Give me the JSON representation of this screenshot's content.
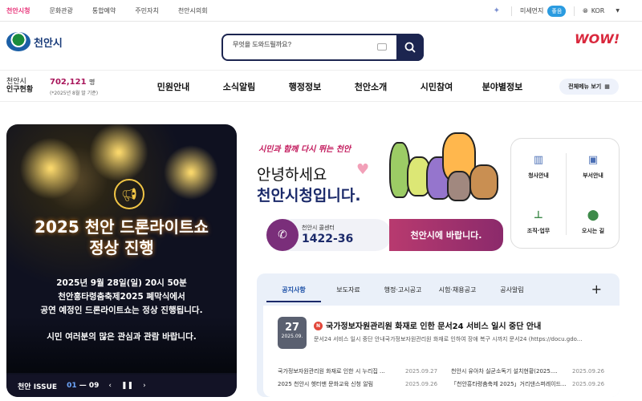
{
  "topbar": {
    "sites": [
      "천안시청",
      "문화관광",
      "통합예약",
      "주민자치",
      "천안시의회"
    ],
    "dust_label": "미세먼지",
    "dust_value": "좋음",
    "lang": "KOR"
  },
  "header": {
    "logo": "천안시",
    "search_placeholder": "무엇을 도와드릴까요?",
    "brand_slogan": "WOW!"
  },
  "population": {
    "label1": "천안시",
    "label2": "인구현황",
    "value": "702,121",
    "unit": "명",
    "date": "(*2025년 8월 말 기준)"
  },
  "nav": {
    "items": [
      "민원안내",
      "소식알림",
      "행정정보",
      "천안소개",
      "시민참여",
      "분야별정보"
    ],
    "all_menu": "전체메뉴 보기"
  },
  "banner": {
    "title1": "2025 천안 드론라이트쇼",
    "title2": "정상 진행",
    "body1": "2025년 9월 28일(일) 20시 50분",
    "body2": "천안흥타령춤축제2025 폐막식에서",
    "body3": "공연 예정인 드론라이트쇼는 정상 진행됩니다.",
    "note": "시민 여러분의 많은 관심과 관람 바랍니다.",
    "issue_label": "천안 ISSUE",
    "page_current": "01",
    "page_total": "09"
  },
  "greeting": {
    "slogan": "시민과 함께 다시 뛰는 천안",
    "line1": "안녕하세요",
    "line2": "천안시청입니다.",
    "call_label": "천안시 콜센터",
    "call_number": "1422-36",
    "wish_button": "천안시에 바랍니다."
  },
  "quick": {
    "items": [
      {
        "label": "청사안내",
        "icon": "building-icon"
      },
      {
        "label": "부서안내",
        "icon": "desk-icon"
      },
      {
        "label": "조직·업무",
        "icon": "org-chart-icon"
      },
      {
        "label": "오시는 길",
        "icon": "map-pin-icon"
      }
    ]
  },
  "news": {
    "tabs": [
      "공지사항",
      "보도자료",
      "행정·고시공고",
      "시험·채용공고",
      "공사알림"
    ],
    "featured": {
      "day": "27",
      "month": "2025.09.",
      "badge": "N",
      "title": "국가정보자원관리원 화재로 인한 문서24 서비스 일시 중단 안내",
      "summary": "문서24 서비스 일시 중단 안내국가정보자원관리원 화재로 인하여 장애 복구 시까지 문서24 (https://docu.gdo..."
    },
    "list": [
      {
        "title": "국가정보자원관리원 화재로 인한 시 누리집 ...",
        "date": "2025.09.27"
      },
      {
        "title": "천안시 유아차 실균소독기 설치현황(2025....",
        "date": "2025.09.26"
      },
      {
        "title": "2025 천안시 헷터맨 문화교육 신청 알림",
        "date": "2025.09.26"
      },
      {
        "title": "「천안흥타령춤축제 2025」거리댄스퍼레이드...",
        "date": "2025.09.26"
      }
    ]
  }
}
